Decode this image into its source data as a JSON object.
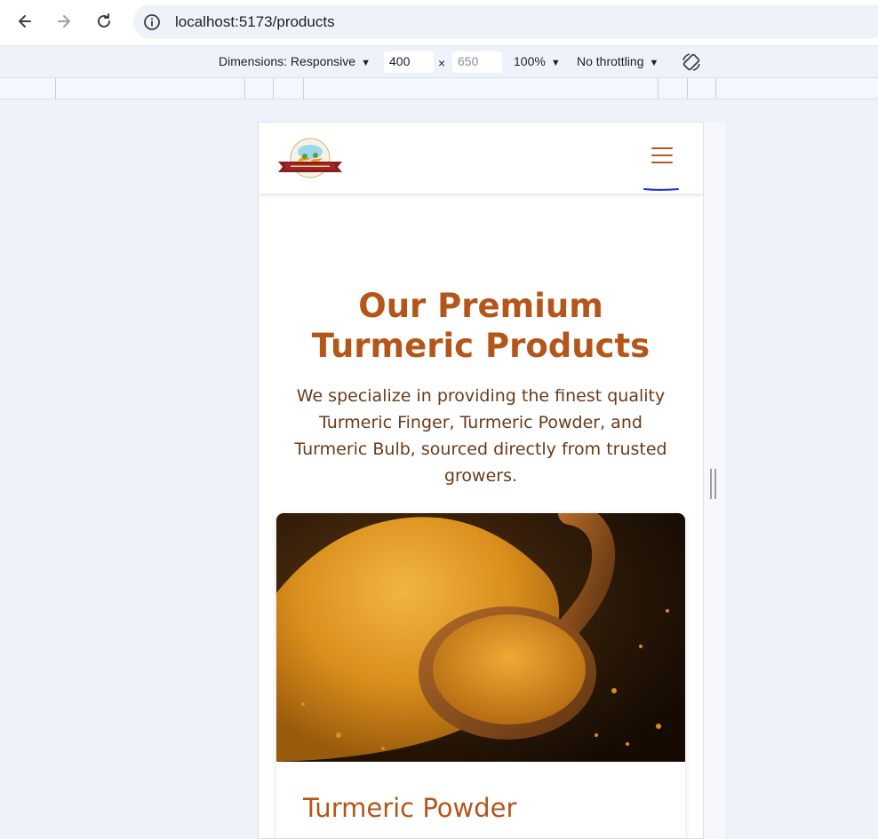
{
  "browser": {
    "url": "localhost:5173/products",
    "back_icon": "arrow-left-icon",
    "forward_icon": "arrow-right-icon",
    "reload_icon": "reload-icon",
    "info_icon": "info-icon"
  },
  "devtools": {
    "dimensions_label": "Dimensions: Responsive",
    "width_value": "400",
    "separator": "×",
    "height_placeholder": "650",
    "zoom_label": "100%",
    "throttling_label": "No throttling",
    "rotate_icon": "rotate-icon"
  },
  "site": {
    "menu_icon": "hamburger-menu-icon",
    "logo_icon": "brand-logo-icon",
    "hero_title": "Our Premium Turmeric Products",
    "hero_description": "We specialize in providing the finest quality Turmeric Finger, Turmeric Powder, and Turmeric Bulb, sourced directly from trusted growers.",
    "products": [
      {
        "name": "Turmeric Powder",
        "image": "turmeric-powder-image"
      }
    ]
  },
  "colors": {
    "brand": "#b4561a",
    "text_brown": "#6b3a1a",
    "devtools_bg": "#eef3fb"
  }
}
